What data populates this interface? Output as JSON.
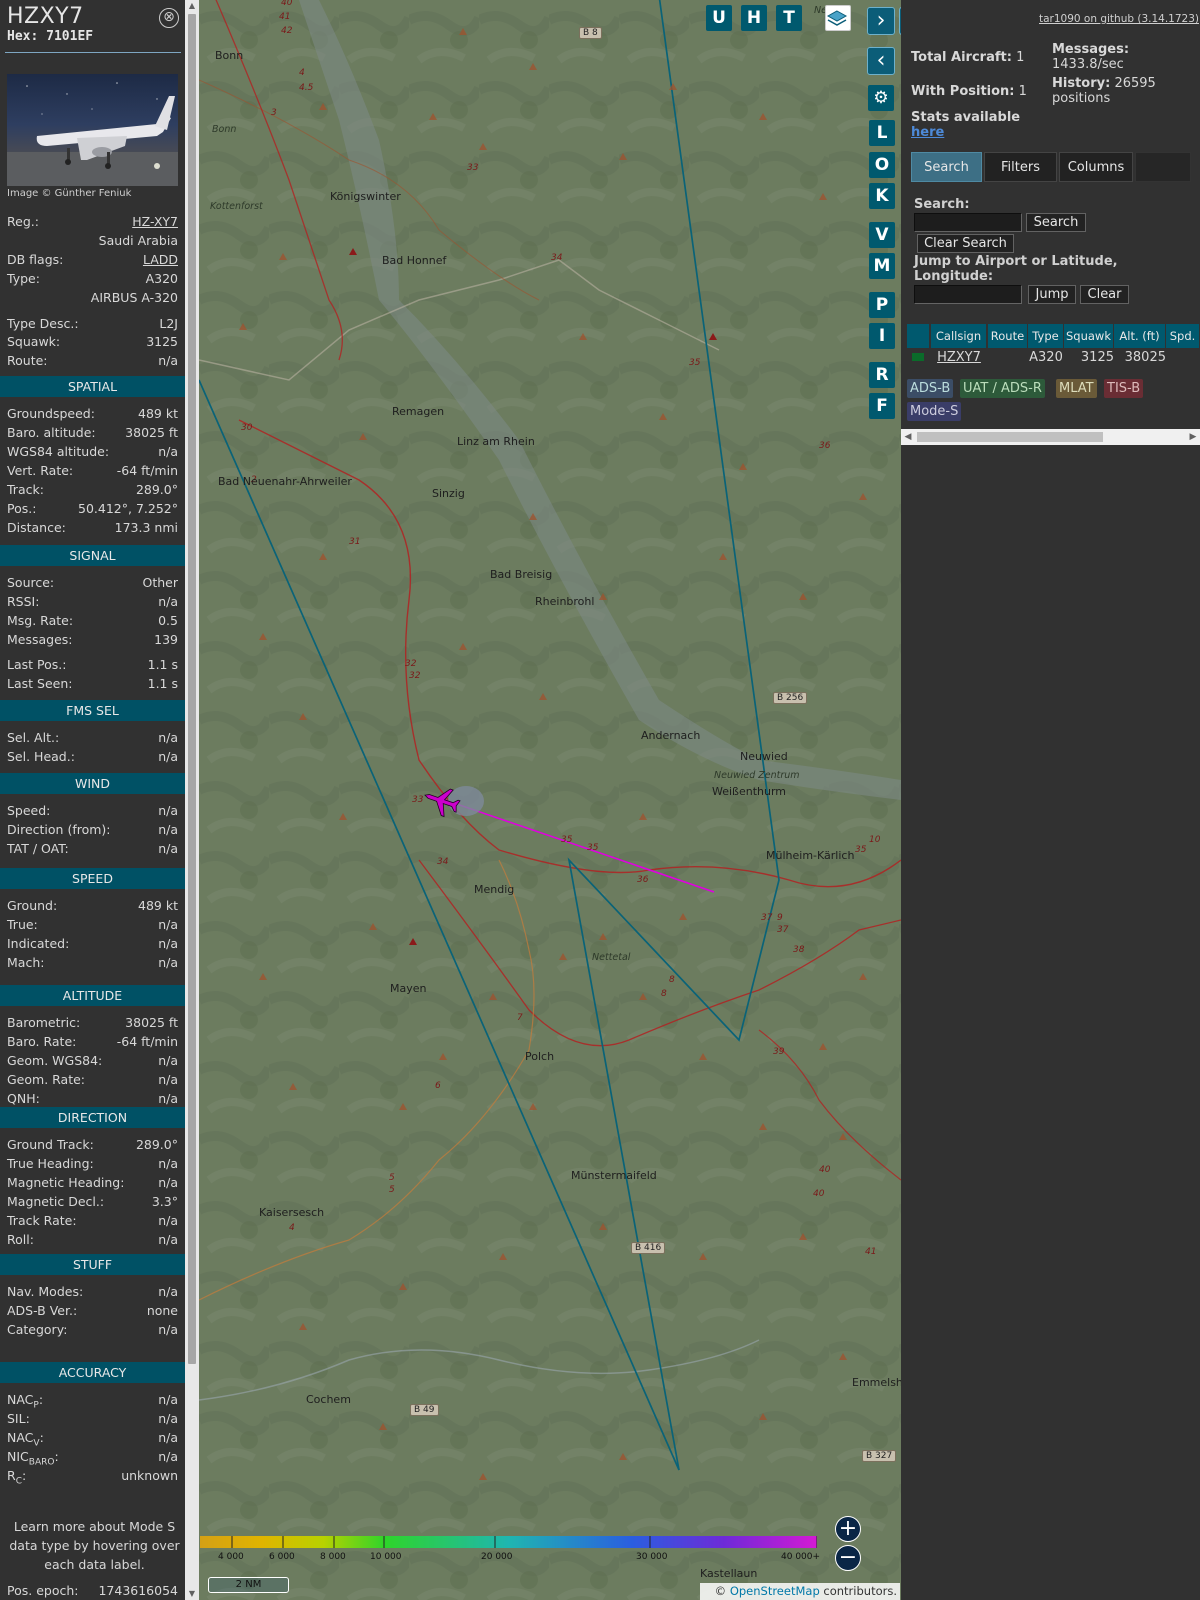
{
  "aircraft": {
    "callsign": "HZXY7",
    "hex_label": "Hex: ",
    "hex": "7101EF",
    "close_icon": "⊗",
    "image_credit": "Image © Günther Feniuk"
  },
  "info_rows": [
    {
      "label": "Reg.:",
      "value": "HZ-XY7",
      "link": true
    },
    {
      "label": "",
      "value": "Saudi Arabia"
    },
    {
      "label": "DB flags:",
      "value": "LADD",
      "link": true
    },
    {
      "label": "Type:",
      "value": "A320"
    },
    {
      "label": "",
      "value": "AIRBUS A-320"
    },
    {
      "label": "Type Desc.:",
      "value": "L2J"
    },
    {
      "label": "Squawk:",
      "value": "3125"
    },
    {
      "label": "Route:",
      "value": "n/a"
    }
  ],
  "sections": [
    {
      "title": "SPATIAL",
      "rows": [
        [
          "Groundspeed:",
          "489 kt"
        ],
        [
          "Baro. altitude:",
          "38025 ft"
        ],
        [
          "WGS84 altitude:",
          "n/a"
        ],
        [
          "Vert. Rate:",
          "-64 ft/min"
        ],
        [
          "Track:",
          "289.0°"
        ],
        [
          "Pos.:",
          "50.412°, 7.252°"
        ],
        [
          "Distance:",
          "173.3 nmi"
        ]
      ]
    },
    {
      "title": "SIGNAL",
      "rows": [
        [
          "Source:",
          "Other"
        ],
        [
          "RSSI:",
          "n/a"
        ],
        [
          "Msg. Rate:",
          "0.5"
        ],
        [
          "Messages:",
          "139"
        ],
        [
          "Last Pos.:",
          "1.1 s"
        ],
        [
          "Last Seen:",
          "1.1 s"
        ]
      ]
    },
    {
      "title": "FMS SEL",
      "rows": [
        [
          "Sel. Alt.:",
          "n/a"
        ],
        [
          "Sel. Head.:",
          "n/a"
        ]
      ]
    },
    {
      "title": "WIND",
      "rows": [
        [
          "Speed:",
          "n/a"
        ],
        [
          "Direction (from):",
          "n/a"
        ],
        [
          "TAT / OAT:",
          "n/a"
        ]
      ]
    },
    {
      "title": "SPEED",
      "rows": [
        [
          "Ground:",
          "489 kt"
        ],
        [
          "True:",
          "n/a"
        ],
        [
          "Indicated:",
          "n/a"
        ],
        [
          "Mach:",
          "n/a"
        ]
      ]
    },
    {
      "title": "ALTITUDE",
      "rows": [
        [
          "Barometric:",
          "38025 ft"
        ],
        [
          "Baro. Rate:",
          "-64 ft/min"
        ],
        [
          "Geom. WGS84:",
          "n/a"
        ],
        [
          "Geom. Rate:",
          "n/a"
        ],
        [
          "QNH:",
          "n/a"
        ]
      ]
    },
    {
      "title": "DIRECTION",
      "rows": [
        [
          "Ground Track:",
          "289.0°"
        ],
        [
          "True Heading:",
          "n/a"
        ],
        [
          "Magnetic Heading:",
          "n/a"
        ],
        [
          "Magnetic Decl.:",
          "3.3°"
        ],
        [
          "Track Rate:",
          "n/a"
        ],
        [
          "Roll:",
          "n/a"
        ]
      ]
    },
    {
      "title": "STUFF",
      "rows": [
        [
          "Nav. Modes:",
          "n/a"
        ],
        [
          "ADS-B Ver.:",
          "none"
        ],
        [
          "Category:",
          "n/a"
        ]
      ]
    },
    {
      "title": "ACCURACY",
      "rows": [
        [
          "NACP:",
          "n/a"
        ],
        [
          "SIL:",
          "n/a"
        ],
        [
          "NACV:",
          "n/a"
        ],
        [
          "NICBARO:",
          "n/a"
        ],
        [
          "RC:",
          "unknown"
        ]
      ]
    }
  ],
  "accuracy_labels": [
    {
      "main": "NAC",
      "sub": "P",
      "tail": ":"
    },
    {
      "main": "SIL",
      "sub": "",
      "tail": ":"
    },
    {
      "main": "NAC",
      "sub": "V",
      "tail": ":"
    },
    {
      "main": "NIC",
      "sub": "BARO",
      "tail": ":"
    },
    {
      "main": "R",
      "sub": "C",
      "tail": ":"
    }
  ],
  "sidebar_note": "Learn more about Mode S data type by hovering over each data label.",
  "pos_epoch": {
    "label": "Pos. epoch:",
    "value": "1743616054"
  },
  "map": {
    "top_buttons": [
      "U",
      "H",
      "T"
    ],
    "side_buttons": [
      "L",
      "O",
      "K",
      "V",
      "M",
      "P",
      "I",
      "R",
      "F"
    ],
    "places": [
      [
        "Bonn",
        215,
        57
      ],
      [
        "Königswinter",
        330,
        198
      ],
      [
        "Bad Honnef",
        382,
        262
      ],
      [
        "Remagen",
        392,
        413
      ],
      [
        "Linz am Rhein",
        457,
        443
      ],
      [
        "Bad Neuenahr-Ahrweiler",
        218,
        483
      ],
      [
        "Sinzig",
        432,
        495
      ],
      [
        "Bad Breisig",
        490,
        576
      ],
      [
        "Rheinbrohl",
        535,
        603
      ],
      [
        "Andernach",
        641,
        737
      ],
      [
        "Neuwied",
        740,
        758
      ],
      [
        "Weißenthurm",
        712,
        793
      ],
      [
        "Mülheim-Kärlich",
        766,
        857
      ],
      [
        "Mendig",
        474,
        891
      ],
      [
        "Mayen",
        390,
        990
      ],
      [
        "Polch",
        525,
        1058
      ],
      [
        "Münstermaifeld",
        571,
        1177
      ],
      [
        "Kaisersesch",
        259,
        1214
      ],
      [
        "Cochem",
        306,
        1401
      ],
      [
        "Kastellaun",
        700,
        1575
      ],
      [
        "Emmelsh",
        852,
        1384
      ]
    ],
    "places_italic": [
      [
        "Kottenforst",
        210,
        208
      ],
      [
        "Bonn",
        212,
        131
      ],
      [
        "Neuwied Zentrum",
        714,
        777
      ],
      [
        "Nettetal",
        592,
        959
      ],
      [
        "Neu",
        814,
        12
      ]
    ],
    "roads": [
      [
        "B 8",
        579,
        34
      ],
      [
        "B 256",
        773,
        699
      ],
      [
        "B 416",
        631,
        1249
      ],
      [
        "B 49",
        410,
        1411
      ],
      [
        "B 327",
        862,
        1457
      ]
    ],
    "legend_ticks": [
      "4 000",
      "6 000",
      "8 000",
      "10 000",
      "20 000",
      "30 000",
      "40 000+"
    ],
    "scale": "2 NM",
    "attribution_prefix": "© ",
    "attribution_link": "OpenStreetMap",
    "attribution_suffix": " contributors."
  },
  "panel": {
    "github": "tar1090 on github (3.14.1723)",
    "total_aircraft": "1",
    "with_position": "1",
    "messages": "1433.8/sec",
    "history": "26595 positions",
    "labels": {
      "total": "Total Aircraft:",
      "withpos": "With Position:",
      "messages": "Messages:",
      "history": "History:",
      "stats": "Stats available",
      "here": "here"
    },
    "tabs": [
      "Search",
      "Filters",
      "Columns"
    ],
    "search_label": "Search:",
    "search_btn": "Search",
    "clear_search_btn": "Clear Search",
    "jump_label": "Jump to Airport or Latitude, Longitude:",
    "jump_btn": "Jump",
    "clear_btn": "Clear",
    "table_headers": [
      "Callsign",
      "Route",
      "Type",
      "Squawk",
      "Alt. (ft)",
      "Spd."
    ],
    "table_row": {
      "callsign": "HZXY7",
      "route": "",
      "type": "A320",
      "squawk": "3125",
      "alt": "38025"
    },
    "badges": [
      "ADS-B",
      "UAT / ADS-R",
      "MLAT",
      "TIS-B",
      "Mode-S"
    ]
  },
  "colors": {
    "accent": "#00596e",
    "track": "#e000e0",
    "aircraft": "#cc00cc"
  }
}
